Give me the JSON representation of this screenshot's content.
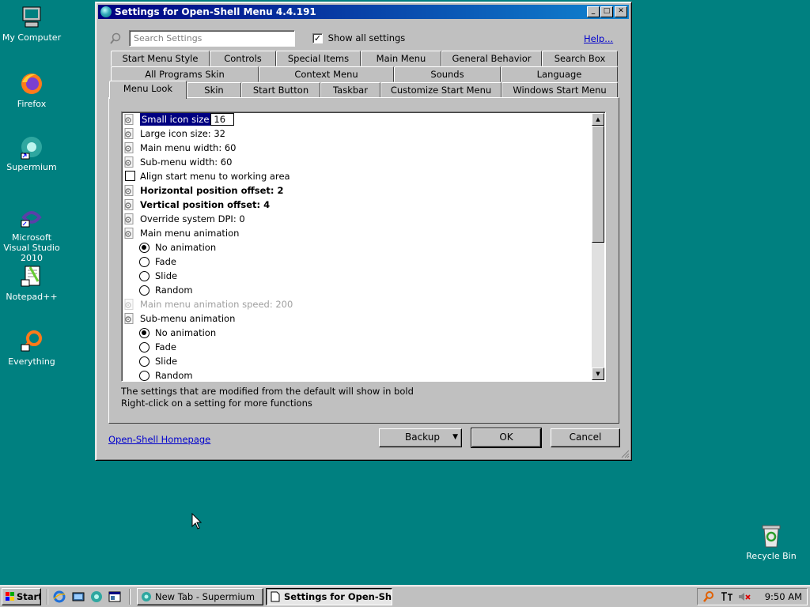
{
  "desktop": {
    "icons": [
      {
        "label": "My Computer",
        "icon": "computer-icon"
      },
      {
        "label": "Firefox",
        "icon": "firefox-icon"
      },
      {
        "label": "Supermium",
        "icon": "supermium-icon"
      },
      {
        "label": "Microsoft Visual Studio 2010",
        "icon": "visual-studio-icon"
      },
      {
        "label": "Notepad++",
        "icon": "notepadpp-icon"
      },
      {
        "label": "Everything",
        "icon": "everything-icon"
      },
      {
        "label": "Recycle Bin",
        "icon": "recycle-bin-icon"
      }
    ]
  },
  "window": {
    "title": "Settings for Open-Shell Menu 4.4.191",
    "search_placeholder": "Search Settings",
    "show_all_label": "Show all settings",
    "show_all_checked": true,
    "help_link": "Help...",
    "tabs_row1": [
      "Start Menu Style",
      "Controls",
      "Special Items",
      "Main Menu",
      "General Behavior",
      "Search Box"
    ],
    "tabs_row2": [
      "All Programs Skin",
      "Context Menu",
      "Sounds",
      "Language"
    ],
    "tabs_row3": [
      "Menu Look",
      "Skin",
      "Start Button",
      "Taskbar",
      "Customize Start Menu",
      "Windows Start Menu"
    ],
    "active_tab": "Menu Look",
    "settings": [
      {
        "kind": "setting",
        "label": "Small icon size",
        "edit_value": "16",
        "selected": true
      },
      {
        "kind": "setting",
        "label": "Large icon size: 32"
      },
      {
        "kind": "setting",
        "label": "Main menu width: 60"
      },
      {
        "kind": "setting",
        "label": "Sub-menu width: 60"
      },
      {
        "kind": "checkbox",
        "label": "Align start menu to working area",
        "checked": false
      },
      {
        "kind": "setting",
        "label": "Horizontal position offset: 2",
        "bold": true
      },
      {
        "kind": "setting",
        "label": "Vertical position offset: 4",
        "bold": true
      },
      {
        "kind": "setting",
        "label": "Override system DPI: 0"
      },
      {
        "kind": "setting",
        "label": "Main menu animation"
      },
      {
        "kind": "radio",
        "label": "No animation",
        "checked": true
      },
      {
        "kind": "radio",
        "label": "Fade",
        "checked": false
      },
      {
        "kind": "radio",
        "label": "Slide",
        "checked": false
      },
      {
        "kind": "radio",
        "label": "Random",
        "checked": false
      },
      {
        "kind": "setting",
        "label": "Main menu animation speed: 200",
        "disabled": true
      },
      {
        "kind": "setting",
        "label": "Sub-menu animation"
      },
      {
        "kind": "radio",
        "label": "No animation",
        "checked": true
      },
      {
        "kind": "radio",
        "label": "Fade",
        "checked": false
      },
      {
        "kind": "radio",
        "label": "Slide",
        "checked": false
      },
      {
        "kind": "radio",
        "label": "Random",
        "checked": false
      }
    ],
    "hint_line1": "The settings that are modified from the default will show in bold",
    "hint_line2": "Right-click on a setting for more functions",
    "homepage_link": "Open-Shell Homepage",
    "backup_label": "Backup",
    "ok_label": "OK",
    "cancel_label": "Cancel"
  },
  "taskbar": {
    "start_label": "Start",
    "tasks": [
      {
        "label": "New Tab - Supermium",
        "active": false
      },
      {
        "label": "Settings for Open-Sh...",
        "active": true
      }
    ],
    "clock": "9:50 AM"
  },
  "colors": {
    "desktop": "#008080",
    "title_start": "#000080",
    "title_end": "#1084d0",
    "selection": "#000080"
  }
}
